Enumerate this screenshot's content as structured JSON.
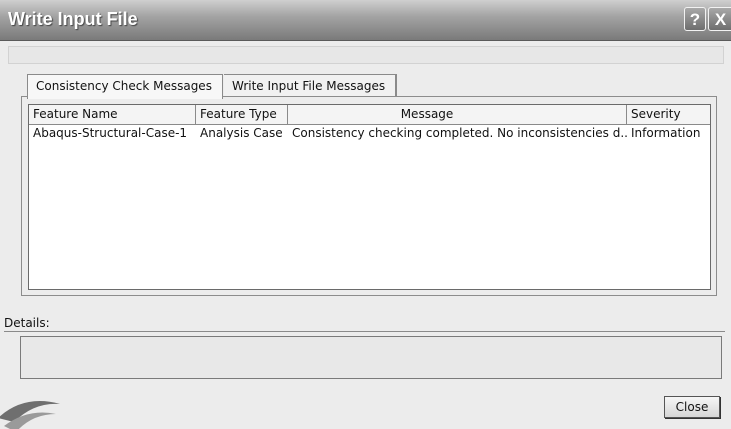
{
  "window": {
    "title": "Write Input File",
    "help_label": "?",
    "close_label": "X"
  },
  "tabs": [
    {
      "label": "Consistency Check Messages",
      "active": true
    },
    {
      "label": "Write Input File Messages",
      "active": false
    }
  ],
  "table": {
    "columns": [
      "Feature Name",
      "Feature Type",
      "Message",
      "Severity"
    ],
    "rows": [
      {
        "feature_name": "Abaqus-Structural-Case-1",
        "feature_type": "Analysis Case",
        "message": "Consistency checking completed. No inconsistencies d...",
        "severity": "Information"
      }
    ]
  },
  "details": {
    "label": "Details:",
    "value": ""
  },
  "footer": {
    "close_button_label": "Close"
  },
  "icons": {
    "help": "help-icon",
    "close": "close-icon",
    "logo": "app-logo-icon"
  }
}
